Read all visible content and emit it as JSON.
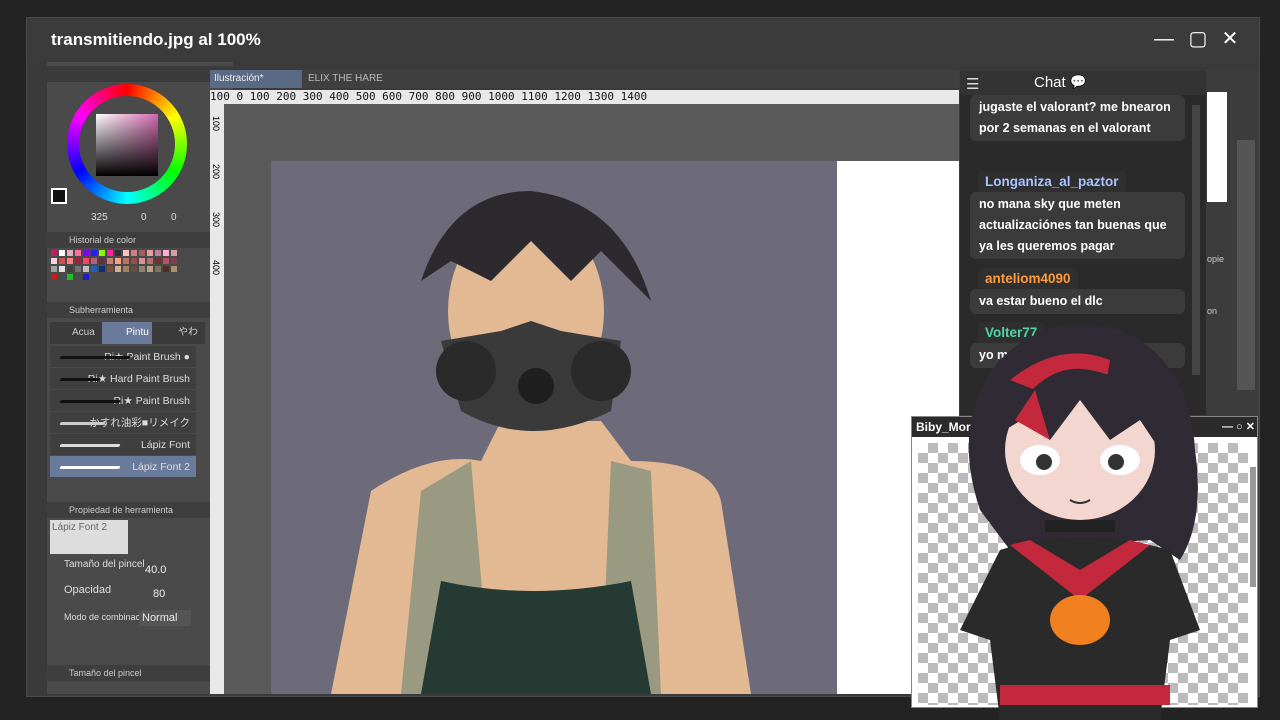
{
  "window": {
    "title": "transmitiendo.jpg al 100%",
    "minimize": "—",
    "maximize": "▢",
    "close": "✕"
  },
  "left_panel": {
    "color_values": [
      "325",
      "0",
      "0"
    ],
    "color_history_label": "Historial de color",
    "subtool_label": "Subherramienta",
    "subtool_tabs": [
      "Acua",
      "Pintu",
      "やわ"
    ],
    "brushes": [
      "Ri★ Paint Brush ●",
      "Ri★ Hard Paint Brush",
      "Ri★ Paint Brush",
      "かすれ油彩■リメイク",
      "Lápiz Font",
      "Lápiz Font 2"
    ],
    "tool_property_label": "Propiedad de herramienta",
    "tool_name": "Lápiz Font 2",
    "brush_size_label": "Tamaño del pincel",
    "brush_size_value": "40.0",
    "opacity_label": "Opacidad",
    "opacity_value": "80",
    "blend_mode_label": "Modo de combinac",
    "blend_mode_value": "Normal",
    "brush_size_panel_label": "Tamaño del pincel"
  },
  "canvas": {
    "tabs": [
      "Ilustración*",
      "ELIX THE HARE"
    ],
    "ruler_h": "100 0 100 200 300 400 500 600 700 800 900 1000 1100 1200 1300 1400",
    "ruler_v": [
      "100",
      "200",
      "300",
      "400"
    ]
  },
  "chat": {
    "title": "Chat",
    "messages": [
      {
        "user": "",
        "user_color": "",
        "text": "jugaste el valorant? me bnearon por 2 semanas en el valorant"
      },
      {
        "user": "Longaniza_al_paztor",
        "user_color": "#a9c4ff",
        "text": "no mana sky que meten actualizaciónes tan buenas que ya les queremos pagar"
      },
      {
        "user": "anteliom4090",
        "user_color": "#ff9a3c",
        "text": "va estar bueno el dlc"
      },
      {
        "user": "Volter77",
        "user_color": "#4fd6a8",
        "text": "yo me la ... no tenia and..."
      }
    ]
  },
  "vtuber": {
    "title": "Biby_Mori"
  },
  "right_panel": {
    "labels": [
      "opie",
      "on"
    ]
  }
}
